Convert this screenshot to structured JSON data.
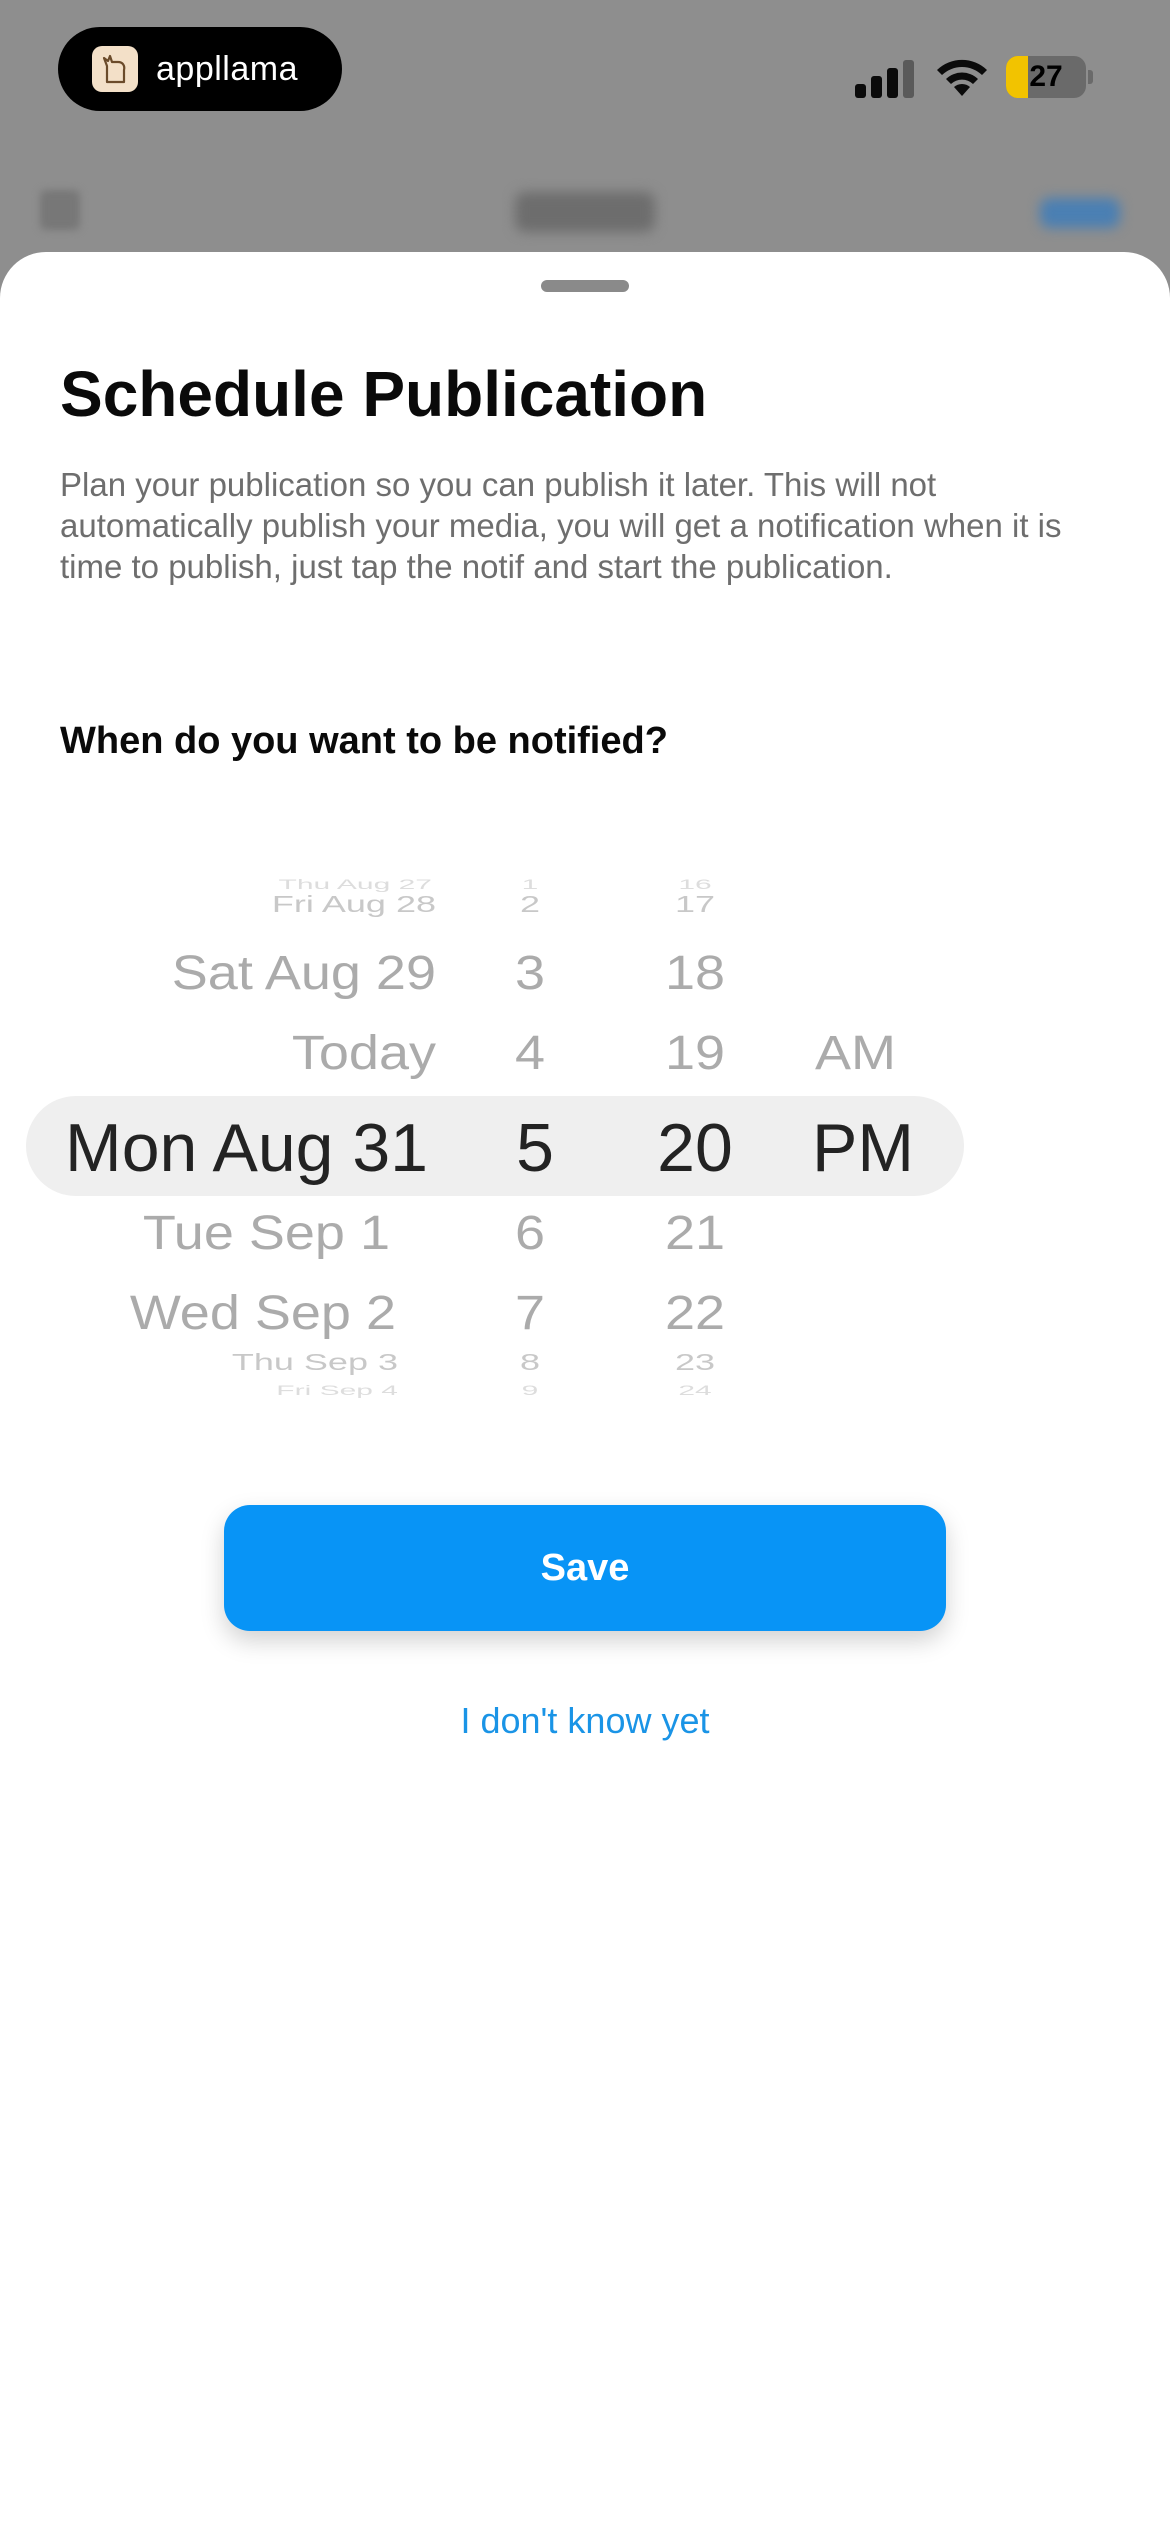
{
  "status_bar": {
    "app_badge": "appllama",
    "battery_level": "27",
    "icons": [
      "app-logo-icon",
      "cellular-signal-icon",
      "wifi-icon",
      "battery-icon"
    ],
    "battery_color": "#f2c300"
  },
  "sheet": {
    "title": "Schedule Publication",
    "description": "Plan your publication so you can publish it later. This will not automatically publish your media, you will get a notification when it is time to publish, just tap the notif and start the publication.",
    "question": "When do you want to be notified?"
  },
  "picker": {
    "date": [
      "Thu Aug 27",
      "Fri Aug 28",
      "Sat Aug 29",
      "Today",
      "Mon Aug 31",
      "Tue Sep 1",
      "Wed Sep 2",
      "Thu Sep 3",
      "Fri Sep 4"
    ],
    "hour": [
      "1",
      "2",
      "3",
      "4",
      "5",
      "6",
      "7",
      "8",
      "9"
    ],
    "minute": [
      "16",
      "17",
      "18",
      "19",
      "20",
      "21",
      "22",
      "23",
      "24"
    ],
    "period": [
      "AM",
      "PM"
    ],
    "selected": {
      "date": "Mon Aug 31",
      "hour": "5",
      "minute": "20",
      "period": "PM"
    }
  },
  "actions": {
    "save_label": "Save",
    "later_label": "I don't know yet"
  },
  "colors": {
    "accent": "#0894f6",
    "link": "#1a94e6"
  }
}
